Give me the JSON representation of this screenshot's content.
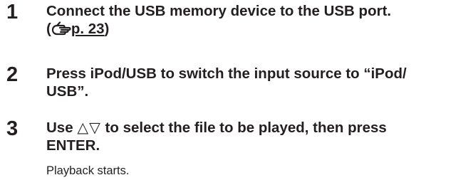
{
  "steps": [
    {
      "number": "1",
      "line1": "Connect the USB memory device to the USB port.",
      "ref_open": "(",
      "ref_icon": "reference-hand-icon",
      "ref_text": "p. 23",
      "ref_close": ")"
    },
    {
      "number": "2",
      "line1": "Press iPod/USB to switch the input source to “iPod/",
      "line2": "USB”."
    },
    {
      "number": "3",
      "line1_before": "Use ",
      "line1_symbols": "△▽",
      "line1_after": " to select the file to be played, then press",
      "line2": "ENTER.",
      "note": "Playback starts."
    }
  ]
}
